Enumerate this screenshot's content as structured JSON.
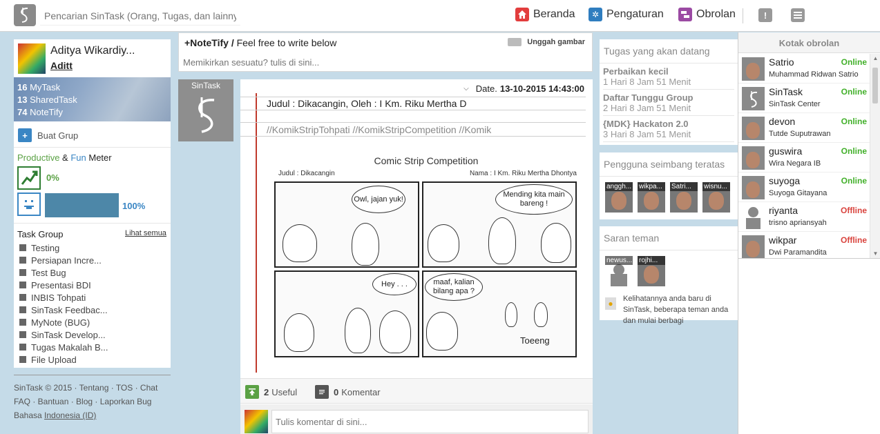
{
  "header": {
    "search_placeholder": "Pencarian SinTask (Orang, Tugas, dan lainnya)",
    "nav": [
      {
        "label": "Beranda",
        "icon": "home-icon",
        "color": "#e23d3d"
      },
      {
        "label": "Pengaturan",
        "icon": "gear-icon",
        "color": "#2f7dbf"
      },
      {
        "label": "Obrolan",
        "icon": "chat-icon",
        "color": "#9b4aa3"
      }
    ],
    "alert_icon": "!",
    "menu_icon": "menu-icon"
  },
  "profile": {
    "name": "Aditya Wikardiy...",
    "username": "Aditt",
    "stats": [
      {
        "count": "16",
        "label": "MyTask"
      },
      {
        "count": "13",
        "label": "SharedTask"
      },
      {
        "count": "74",
        "label": "NoteTify"
      }
    ],
    "create_group": "Buat Grup",
    "meter": {
      "word1": "Productive",
      "amp": "&",
      "word2": "Fun",
      "word3": "Meter",
      "productive_pct": "0%",
      "fun_pct": "100%",
      "fun_value": 1.0
    },
    "task_group_title": "Task Group",
    "see_all": "Lihat semua",
    "task_groups": [
      "Testing",
      "Persiapan Incre...",
      "Test Bug",
      "Presentasi BDI",
      "INBIS Tohpati",
      "SinTask Feedbac...",
      "MyNote (BUG)",
      "SinTask Develop...",
      "Tugas Makalah B...",
      "File Upload"
    ]
  },
  "footer": {
    "line1": "SinTask © 2015 · Tentang · TOS · Chat",
    "line2": "FAQ · Bantuan · Blog · Laporkan Bug",
    "lang_prefix": "Bahasa",
    "lang": "Indonesia (ID)"
  },
  "notetify": {
    "title": "+NoteTify /",
    "subtitle": "Feel free to write below",
    "upload": "Unggah gambar",
    "placeholder": "Memikirkan sesuatu? tulis di sini..."
  },
  "post": {
    "author_label": "SinTask",
    "date_label": "Date.",
    "date_value": "13-10-2015 14:43:00",
    "title": "Judul : Dikacangin, Oleh : I Km. Riku Mertha D",
    "tags": "//KomikStripTohpati //KomikStripCompetition //Komik",
    "comic": {
      "title": "Comic Strip Competition",
      "judul": "Judul : Dikacangin",
      "nama": "Nama : I Km. Riku Mertha Dhontya",
      "bubbles": [
        "Owl, jajan yuk!",
        "Mending kita main bareng !",
        "Hey . . .",
        "maaf, kalian bilang apa ?",
        "Toeeng"
      ]
    },
    "useful_count": "2",
    "useful_label": "Useful",
    "comment_count": "0",
    "comment_label": "Komentar",
    "comment_placeholder": "Tulis komentar di sini..."
  },
  "upcoming": {
    "title": "Tugas yang akan datang",
    "items": [
      {
        "title": "Perbaikan kecil",
        "due": "1 Hari 8 Jam 51 Menit"
      },
      {
        "title": "Daftar Tunggu Group",
        "due": "2 Hari 8 Jam 51 Menit"
      },
      {
        "title": "{MDK} Hackaton 2.0",
        "due": "3 Hari 8 Jam 51 Menit"
      }
    ]
  },
  "balanced_users": {
    "title": "Pengguna seimbang teratas",
    "users": [
      "anggh...",
      "wikpa...",
      "Satri...",
      "wisnu..."
    ]
  },
  "friend_suggest": {
    "title": "Saran teman",
    "users": [
      "newus...",
      "rojhi..."
    ],
    "tip": "Kelihatannya anda baru di SinTask, beberapa teman anda dan mulai berbagi"
  },
  "chat": {
    "title": "Kotak obrolan",
    "items": [
      {
        "name": "Satrio",
        "sub": "Muhammad Ridwan Satrio",
        "status": "Online"
      },
      {
        "name": "SinTask",
        "sub": "SinTask Center",
        "status": "Online"
      },
      {
        "name": "devon",
        "sub": "Tutde Suputrawan",
        "status": "Online"
      },
      {
        "name": "guswira",
        "sub": "Wira Negara IB",
        "status": "Online"
      },
      {
        "name": "suyoga",
        "sub": "Suyoga Gitayana",
        "status": "Online"
      },
      {
        "name": "riyanta",
        "sub": "trisno apriansyah",
        "status": "Offline"
      },
      {
        "name": "wikpar",
        "sub": "Dwi Paramandita",
        "status": "Offline"
      }
    ]
  }
}
